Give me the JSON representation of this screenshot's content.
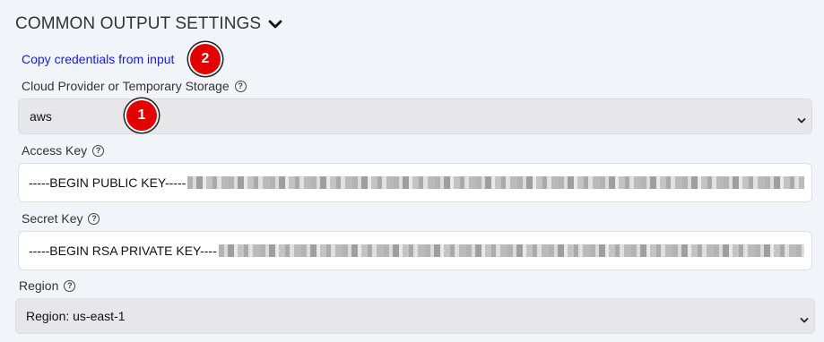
{
  "section": {
    "title": "COMMON OUTPUT SETTINGS",
    "toggle_icon": "chevron-down-icon"
  },
  "copy_link": "Copy credentials from input",
  "badges": {
    "one": "1",
    "two": "2",
    "color": "#e30000"
  },
  "provider": {
    "label": "Cloud Provider or Temporary Storage",
    "value": "aws"
  },
  "access_key": {
    "label": "Access Key",
    "value": "-----BEGIN PUBLIC KEY-----"
  },
  "secret_key": {
    "label": "Secret Key",
    "value": "-----BEGIN RSA PRIVATE KEY----"
  },
  "region": {
    "label": "Region",
    "value": "Region: us-east-1"
  },
  "help_glyph": "?",
  "colors": {
    "link": "#1a1ae6",
    "background": "#f1f4f9",
    "select_bg": "#e7e7ea"
  }
}
